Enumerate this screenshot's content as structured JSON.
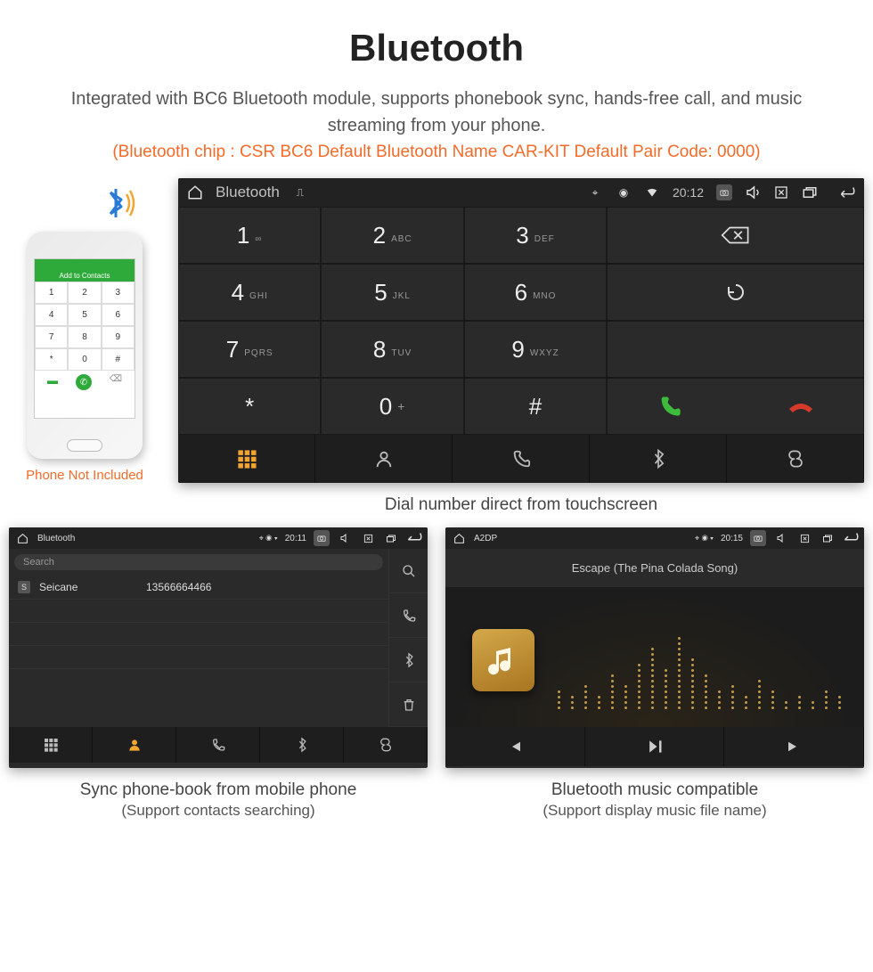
{
  "header": {
    "title": "Bluetooth",
    "subtitle": "Integrated with BC6 Bluetooth module, supports phonebook sync, hands-free call, and music streaming from your phone.",
    "spec": "(Bluetooth chip : CSR BC6     Default Bluetooth Name CAR-KIT     Default Pair Code: 0000)"
  },
  "phone_note": "Phone Not Included",
  "phone_screen": {
    "add_label": "Add to Contacts",
    "keys": [
      "1",
      "2",
      "3",
      "4",
      "5",
      "6",
      "7",
      "8",
      "9",
      "*",
      "0",
      "#"
    ]
  },
  "dialer": {
    "title": "Bluetooth",
    "time": "20:12",
    "keys": [
      {
        "num": "1",
        "sub": "∞"
      },
      {
        "num": "2",
        "sub": "ABC"
      },
      {
        "num": "3",
        "sub": "DEF"
      },
      {
        "num": "4",
        "sub": "GHI"
      },
      {
        "num": "5",
        "sub": "JKL"
      },
      {
        "num": "6",
        "sub": "MNO"
      },
      {
        "num": "7",
        "sub": "PQRS"
      },
      {
        "num": "8",
        "sub": "TUV"
      },
      {
        "num": "9",
        "sub": "WXYZ"
      },
      {
        "num": "*",
        "sub": ""
      },
      {
        "num": "0",
        "sub": "+"
      },
      {
        "num": "#",
        "sub": ""
      }
    ],
    "caption": "Dial number direct from touchscreen"
  },
  "contacts": {
    "title": "Bluetooth",
    "time": "20:11",
    "search_placeholder": "Search",
    "items": [
      {
        "badge": "S",
        "name": "Seicane",
        "number": "13566664466"
      }
    ],
    "caption_line1": "Sync phone-book from mobile phone",
    "caption_line2": "(Support contacts searching)"
  },
  "a2dp": {
    "title": "A2DP",
    "time": "20:15",
    "song": "Escape (The Pina Colada Song)",
    "caption_line1": "Bluetooth music compatible",
    "caption_line2": "(Support display music file name)"
  }
}
